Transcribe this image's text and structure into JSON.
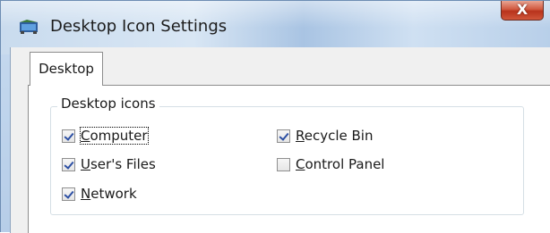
{
  "window": {
    "title": "Desktop Icon Settings",
    "close_glyph": "X",
    "app_icon": "desktop-settings-icon"
  },
  "tabs": [
    {
      "label": "Desktop",
      "selected": true
    }
  ],
  "group": {
    "label": "Desktop icons"
  },
  "checkboxes": [
    {
      "mnemonic": "C",
      "rest": "omputer",
      "checked": true,
      "focused": true
    },
    {
      "mnemonic": "U",
      "rest": "ser's Files",
      "checked": true,
      "focused": false
    },
    {
      "mnemonic": "N",
      "rest": "etwork",
      "checked": true,
      "focused": false
    },
    {
      "mnemonic": "R",
      "rest": "ecycle Bin",
      "checked": true,
      "focused": false
    },
    {
      "mnemonic": "C",
      "rest": "ontrol Panel",
      "checked": false,
      "focused": false
    }
  ],
  "colors": {
    "close_button": "#c9432b",
    "check_mark": "#2c4fa3"
  }
}
